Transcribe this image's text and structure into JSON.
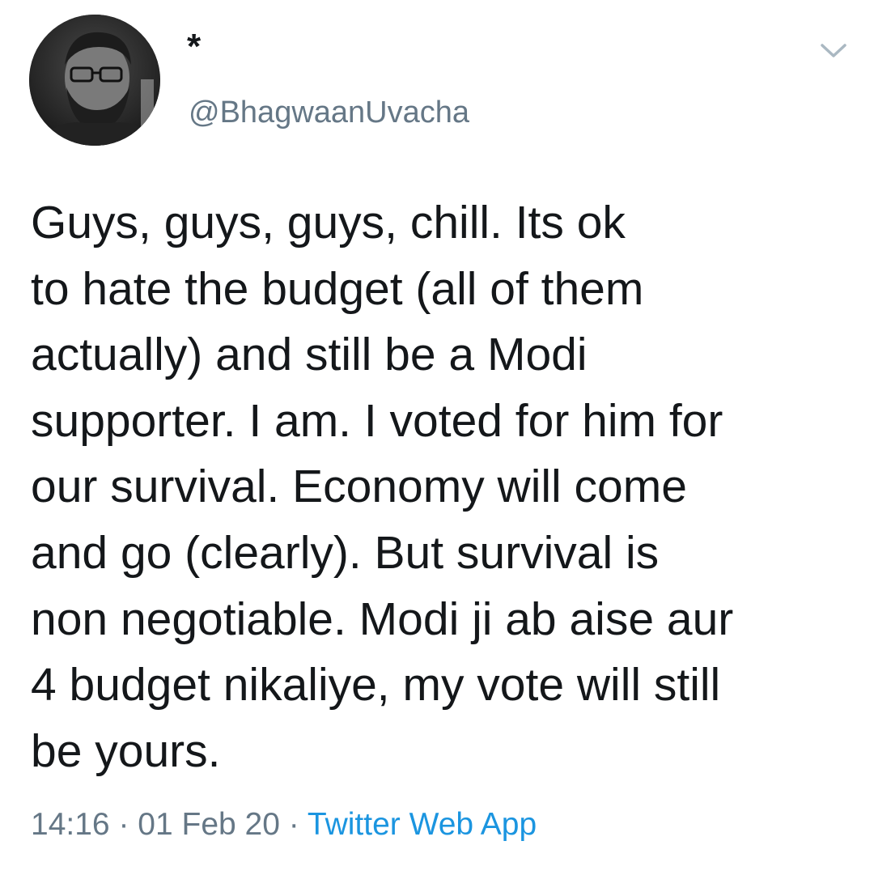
{
  "author": {
    "display_name": "*",
    "handle": "@BhagwaanUvacha",
    "avatar_icon": "profile-photo"
  },
  "menu": {
    "icon": "chevron-down-icon",
    "color": "#aab8c2"
  },
  "tweet": {
    "lines": [
      "Guys, guys, guys, chill. Its ok",
      "to hate the budget (all of them",
      "actually) and still be a Modi",
      "supporter. I am. I voted for him for",
      "our survival. Economy will come",
      "and go (clearly). But survival is",
      "non negotiable. Modi ji ab aise aur",
      "4 budget nikaliye, my vote will still",
      "be yours."
    ]
  },
  "meta": {
    "time": "14:16",
    "separator": "·",
    "date": "01 Feb 20",
    "source": "Twitter Web App"
  },
  "colors": {
    "text": "#14171a",
    "secondary": "#657786",
    "link": "#1b95e0"
  }
}
